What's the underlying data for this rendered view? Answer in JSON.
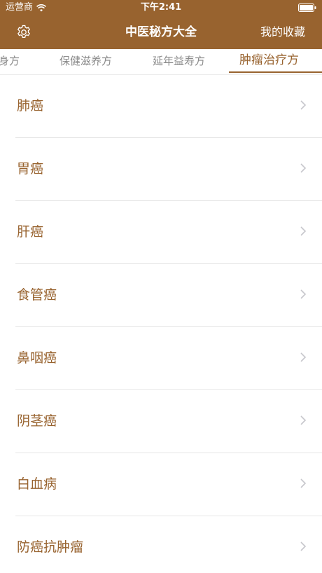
{
  "status_bar": {
    "carrier": "运营商",
    "time": "下午2:41"
  },
  "nav": {
    "title": "中医秘方大全",
    "favorites_label": "我的收藏"
  },
  "tabs": [
    {
      "label": "身方"
    },
    {
      "label": "保健滋养方"
    },
    {
      "label": "延年益寿方"
    },
    {
      "label": "肿瘤治疗方"
    }
  ],
  "active_tab": "肿瘤治疗方",
  "list": {
    "items": [
      {
        "label": "肺癌"
      },
      {
        "label": "胃癌"
      },
      {
        "label": "肝癌"
      },
      {
        "label": "食管癌"
      },
      {
        "label": "鼻咽癌"
      },
      {
        "label": "阴茎癌"
      },
      {
        "label": "白血病"
      },
      {
        "label": "防癌抗肿瘤"
      }
    ]
  },
  "colors": {
    "brand": "#98632f",
    "tab_inactive": "#8a8a8a",
    "divider": "#e6e6e6"
  },
  "icons": {
    "settings": "gear-icon",
    "wifi": "wifi-icon",
    "battery": "battery-icon",
    "row_disclosure": "chevron-right-icon"
  }
}
